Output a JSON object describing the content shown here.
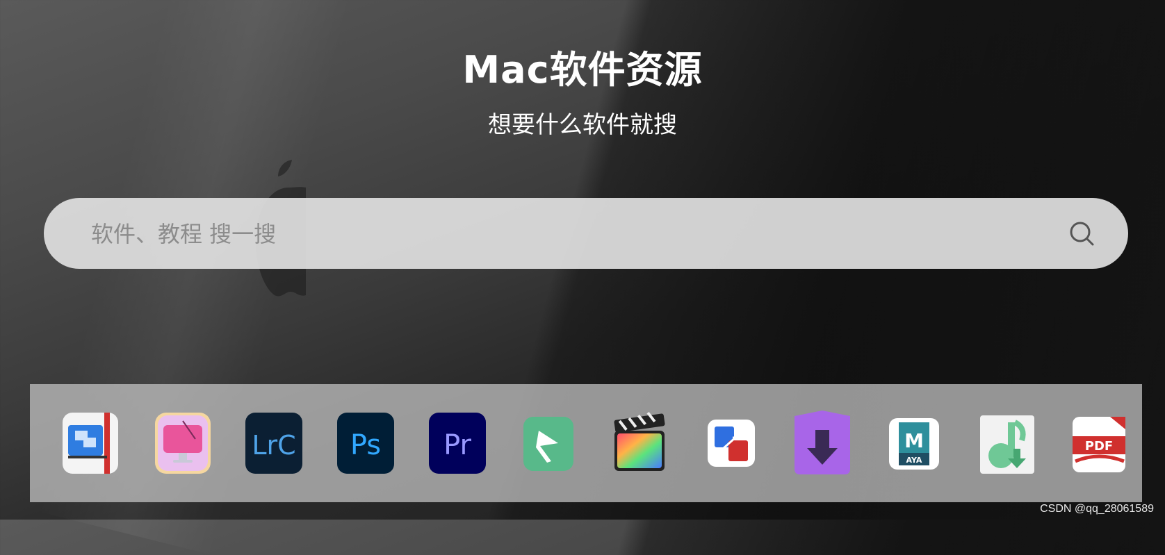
{
  "header": {
    "title": "Mac软件资源",
    "subtitle": "想要什么软件就搜"
  },
  "search": {
    "placeholder": "软件、教程 搜一搜",
    "value": ""
  },
  "dock": {
    "apps": [
      {
        "icon": "app-window-manager-icon"
      },
      {
        "icon": "cleanmymac-icon"
      },
      {
        "icon": "lightroom-classic-icon",
        "label": "LrC"
      },
      {
        "icon": "photoshop-icon",
        "label": "Ps"
      },
      {
        "icon": "premiere-pro-icon",
        "label": "Pr"
      },
      {
        "icon": "green-arrow-app-icon"
      },
      {
        "icon": "final-cut-pro-icon"
      },
      {
        "icon": "parallels-migration-icon"
      },
      {
        "icon": "downie-icon"
      },
      {
        "icon": "maya-icon",
        "label": "M",
        "sublabel": "AYA"
      },
      {
        "icon": "music-downloader-icon"
      },
      {
        "icon": "pdf-reader-icon",
        "label": "PDF"
      }
    ]
  },
  "watermark": "CSDN @qq_28061589",
  "colors": {
    "lrc_bg": "#0b1f33",
    "lrc_fg": "#4fa3e8",
    "ps_bg": "#001e36",
    "ps_fg": "#31a8ff",
    "pr_bg": "#00005b",
    "pr_fg": "#9999ff",
    "maya_teal": "#2e8f9c",
    "pdf_red": "#d0302e",
    "downie_purple": "#a865e8"
  }
}
